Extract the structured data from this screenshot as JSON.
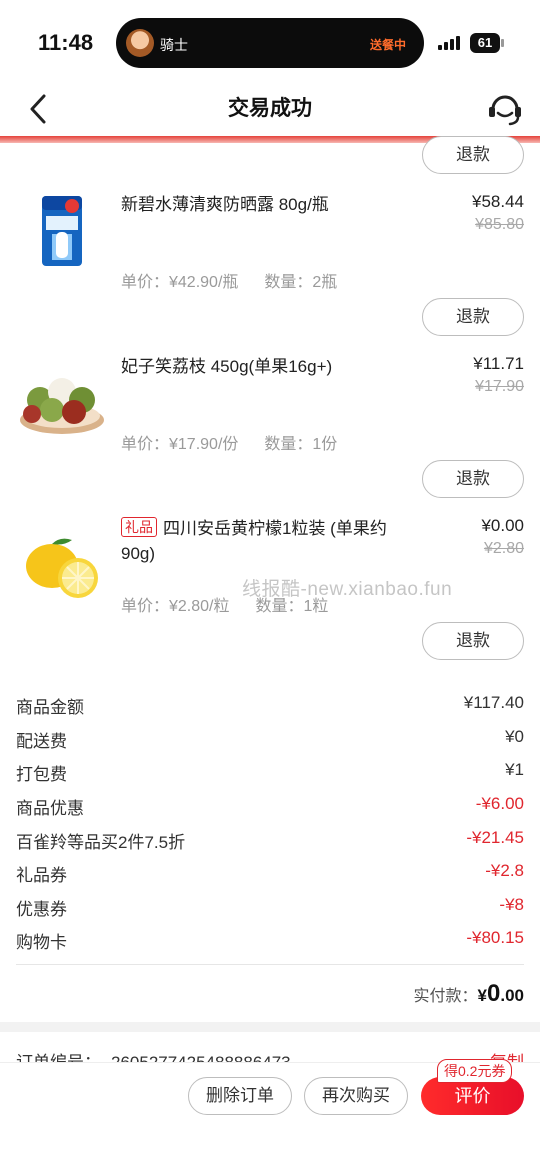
{
  "status_bar": {
    "time": "11:48",
    "island_name": "骑士",
    "island_status": "送餐中",
    "battery": "61"
  },
  "nav": {
    "title": "交易成功"
  },
  "refund_label": "退款",
  "items": [
    {
      "title": "新碧水薄清爽防晒露 80g/瓶",
      "price": "¥58.44",
      "original_price": "¥85.80",
      "unit_price": "单价：¥42.90/瓶",
      "quantity": "数量：2瓶",
      "image": "sunscreen-product-icon"
    },
    {
      "title": "妃子笑荔枝 450g(单果16g+)",
      "price": "¥11.71",
      "original_price": "¥17.90",
      "unit_price": "单价：¥17.90/份",
      "quantity": "数量：1份",
      "image": "lychee-product-icon"
    },
    {
      "tag": "礼品",
      "title": "四川安岳黄柠檬1粒装 (单果约90g)",
      "price": "¥0.00",
      "original_price": "¥2.80",
      "unit_price": "单价：¥2.80/粒",
      "quantity": "数量：1粒",
      "image": "lemon-product-icon"
    }
  ],
  "watermark": "线报酷-new.xianbao.fun",
  "summary": [
    {
      "label": "商品金额",
      "value": "¥117.40",
      "discount": false
    },
    {
      "label": "配送费",
      "value": "¥0",
      "discount": false
    },
    {
      "label": "打包费",
      "value": "¥1",
      "discount": false
    },
    {
      "label": "商品优惠",
      "value": "-¥6.00",
      "discount": true
    },
    {
      "label": "百雀羚等品买2件7.5折",
      "value": "-¥21.45",
      "discount": true
    },
    {
      "label": "礼品券",
      "value": "-¥2.8",
      "discount": true
    },
    {
      "label": "优惠券",
      "value": "-¥8",
      "discount": true
    },
    {
      "label": "购物卡",
      "value": "-¥80.15",
      "discount": true
    }
  ],
  "paid": {
    "label": "实付款：",
    "currency": "¥",
    "integer": "0",
    "decimal": ".00"
  },
  "order": {
    "label": "订单编号：",
    "number": "2605277425488886473",
    "copy": "复制"
  },
  "bottom": {
    "delete_label": "删除订单",
    "rebuy_label": "再次购买",
    "review_label": "评价",
    "coupon_badge": "得0.2元券"
  },
  "colors": {
    "accent_red": "#e0262e",
    "muted_gray": "#9a9a9a"
  }
}
